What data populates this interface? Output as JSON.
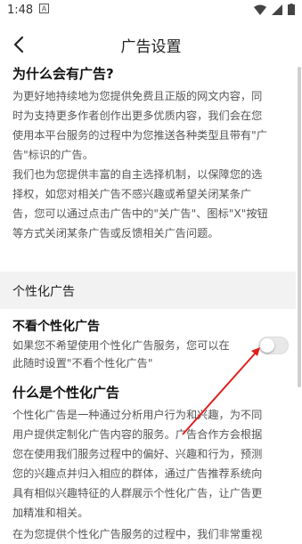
{
  "status": {
    "time": "1:48",
    "notification_icon": "a-box-icon"
  },
  "nav": {
    "title": "广告设置"
  },
  "intro": {
    "heading": "为什么会有广告?",
    "paragraph1": [
      "为更好地持续地为您提供免费且正版的网文内容，同",
      "时为支持更多作者创作出更多优质内容，我们会在您",
      "使用本平台服务的过程中为您推送各种类型且带有\"广",
      "告\"标识的广告。"
    ],
    "paragraph2": [
      "我们也为您提供丰富的自主选择机制，以保障您的选",
      "择权，如您对相关广告不感兴趣或希望关闭某条广",
      "告，您可以通过点击广告中的\"关广告\"、图标\"X\"按钮",
      "等方式关闭某条广告或反馈相关广告问题。"
    ]
  },
  "section": {
    "label": "个性化广告"
  },
  "personalization": {
    "toggle_title": "不看个性化广告",
    "toggle_desc": [
      "如果您不希望使用个性化广告服务，您可以在",
      "此随时设置\"不看个性化广告\""
    ],
    "toggle_on": false
  },
  "what_is": {
    "heading": "什么是个性化广告",
    "paragraph": [
      "个性化广告是一种通过分析用户行为和兴趣，为不同",
      "用户提供定制化广告内容的服务。广告合作方会根据",
      "您在使用我们服务过程中的偏好、兴趣和行为，预测",
      "您的兴趣点并归入相应的群体，通过广告推荐系统向",
      "具有相似兴趣特征的人群展示个性化广告，让广告更",
      "加精准和相关。"
    ],
    "cut_line": "在为您提供个性化广告服务的过程中，我们非常重视"
  },
  "colors": {
    "annotation": "#e02020",
    "section_bg": "#f2f2f2"
  }
}
